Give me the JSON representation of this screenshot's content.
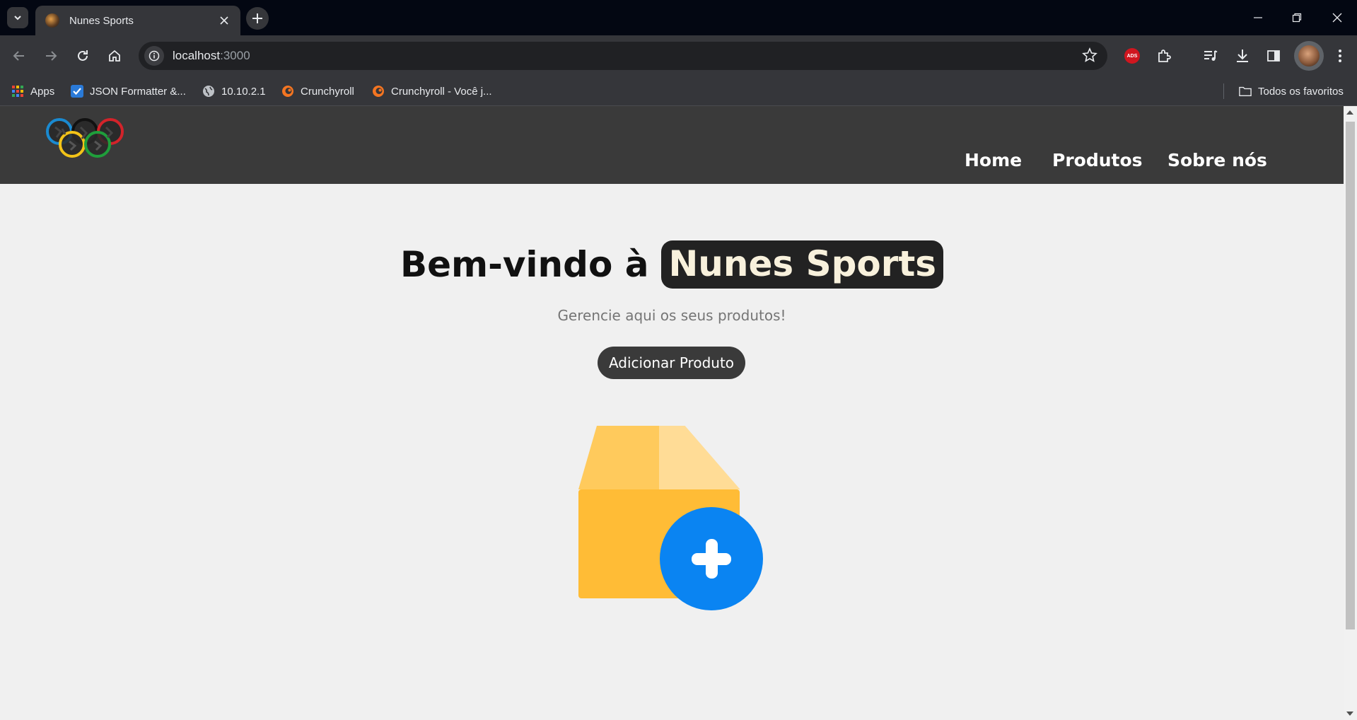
{
  "browser": {
    "tab": {
      "title": "Nunes Sports"
    },
    "url": {
      "host": "localhost",
      "port": ":3000"
    },
    "bookmarks": [
      {
        "label": "Apps",
        "icon": "apps-grid-icon"
      },
      {
        "label": "JSON Formatter &...",
        "icon": "checkbox-icon"
      },
      {
        "label": "10.10.2.1",
        "icon": "globe-icon"
      },
      {
        "label": "Crunchyroll",
        "icon": "crunchyroll-icon"
      },
      {
        "label": "Crunchyroll - Você j...",
        "icon": "crunchyroll-icon"
      }
    ],
    "all_bookmarks_label": "Todos os favoritos",
    "ads_badge": "ADS"
  },
  "page": {
    "nav": {
      "home": "Home",
      "products": "Produtos",
      "about": "Sobre nós"
    },
    "hero": {
      "welcome": "Bem-vindo à",
      "brand": "Nunes Sports",
      "subtitle": "Gerencie aqui os seus produtos!",
      "add_button": "Adicionar Produto"
    }
  },
  "colors": {
    "header_bg": "#3a3a3a",
    "page_bg": "#f0f0f0",
    "brand_pill_bg": "#222222",
    "brand_text": "#f8f1dc",
    "box_yellow": "#ffbc36",
    "plus_blue": "#0a84f2"
  }
}
